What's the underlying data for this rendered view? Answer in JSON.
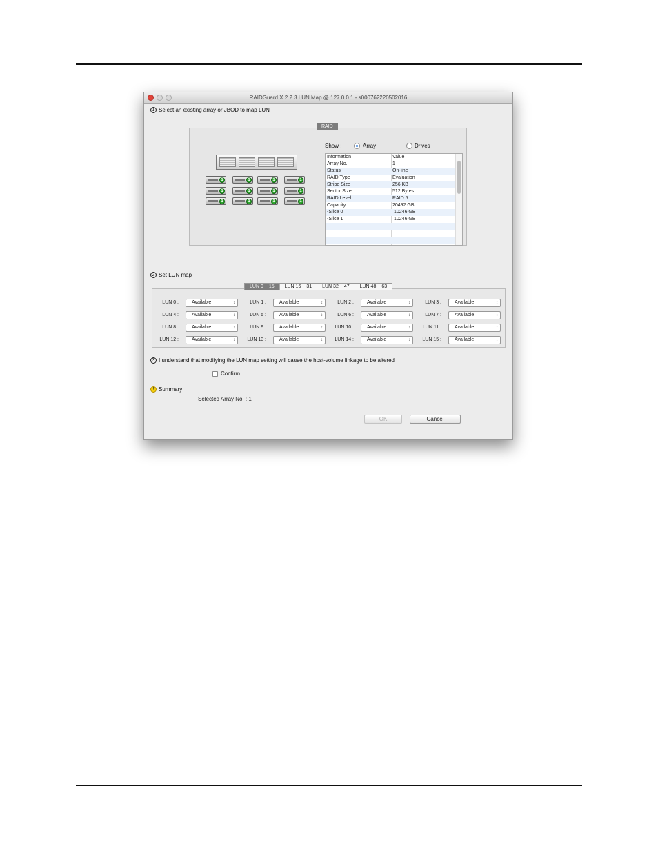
{
  "window": {
    "title": "RAIDGuard X 2.2.3 LUN Map @ 127.0.0.1 - s000762220502016"
  },
  "step1": {
    "number": "1",
    "label": "Select an existing array or JBOD to map LUN"
  },
  "raid_panel": {
    "tab_label": "RAID",
    "show_label": "Show :",
    "options": [
      "Array",
      "Drives"
    ],
    "selected_option": "Array",
    "drive_badge": "1",
    "table": {
      "headers": [
        "Information",
        "Value"
      ],
      "rows": [
        [
          "Array No.",
          "1"
        ],
        [
          "Status",
          "On-line"
        ],
        [
          "RAID Type",
          "Evaluation"
        ],
        [
          "Stripe Size",
          "256 KB"
        ],
        [
          "Sector Size",
          "512 Bytes"
        ],
        [
          "RAID Level",
          "RAID 5"
        ],
        [
          "Capacity",
          "20492 GB"
        ],
        [
          "-Slice 0",
          "10246 GB"
        ],
        [
          "-Slice 1",
          "10246 GB"
        ]
      ]
    }
  },
  "step2": {
    "number": "2",
    "label": "Set LUN map",
    "tabs": [
      "LUN 0 ~ 15",
      "LUN 16 ~ 31",
      "LUN 32 ~ 47",
      "LUN 48 ~ 63"
    ],
    "active_tab": "LUN 0 ~ 15",
    "luns": [
      {
        "label": "LUN 0 :",
        "value": "Available"
      },
      {
        "label": "LUN 1 :",
        "value": "Available"
      },
      {
        "label": "LUN 2 :",
        "value": "Available"
      },
      {
        "label": "LUN 3 :",
        "value": "Available"
      },
      {
        "label": "LUN 4 :",
        "value": "Available"
      },
      {
        "label": "LUN 5 :",
        "value": "Available"
      },
      {
        "label": "LUN 6 :",
        "value": "Available"
      },
      {
        "label": "LUN 7 :",
        "value": "Available"
      },
      {
        "label": "LUN 8 :",
        "value": "Available"
      },
      {
        "label": "LUN 9 :",
        "value": "Available"
      },
      {
        "label": "LUN 10 :",
        "value": "Available"
      },
      {
        "label": "LUN 11 :",
        "value": "Available"
      },
      {
        "label": "LUN 12 :",
        "value": "Available"
      },
      {
        "label": "LUN 13 :",
        "value": "Available"
      },
      {
        "label": "LUN 14 :",
        "value": "Available"
      },
      {
        "label": "LUN 15 :",
        "value": "Available"
      }
    ]
  },
  "step3": {
    "number": "3",
    "label": "I understand that modifying the LUN map setting will cause the host-volume linkage to be altered",
    "confirm_label": "Confirm",
    "confirm_checked": false
  },
  "summary": {
    "icon_text": "!",
    "label": "Summary",
    "selected_array": "Selected Array No. : 1"
  },
  "buttons": {
    "ok_label": "OK",
    "ok_enabled": false,
    "cancel_label": "Cancel"
  }
}
